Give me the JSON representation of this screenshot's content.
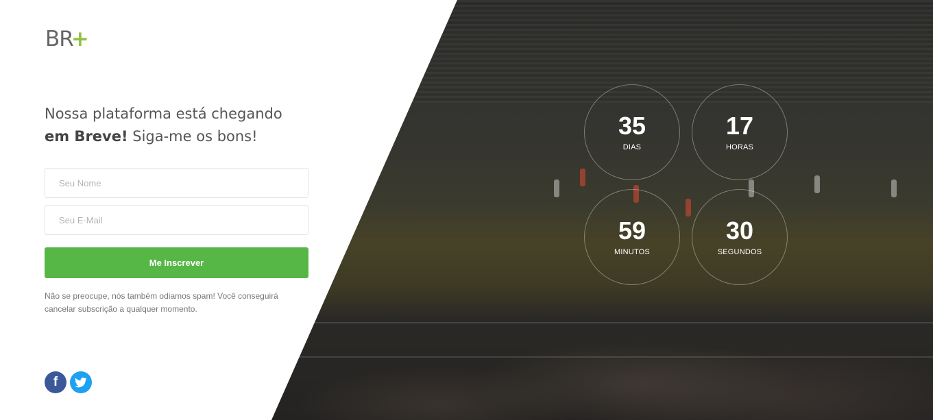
{
  "brand": {
    "logo_text": "BR",
    "logo_plus": "+"
  },
  "headline": {
    "line1": "Nossa plataforma está chegando",
    "bold": "em Breve!",
    "rest": " Siga-me os bons!"
  },
  "form": {
    "name_placeholder": "Seu Nome",
    "email_placeholder": "Seu E-Mail",
    "submit_label": "Me Inscrever"
  },
  "note": "Não se preocupe, nós também odiamos spam! Você conseguirá cancelar subscrição a qualquer momento.",
  "social": {
    "facebook_glyph": "f",
    "facebook": "facebook-icon",
    "twitter": "twitter-icon"
  },
  "countdown": {
    "days": {
      "value": "35",
      "label": "DIAS"
    },
    "hours": {
      "value": "17",
      "label": "HORAS"
    },
    "minutes": {
      "value": "59",
      "label": "MINUTOS"
    },
    "seconds": {
      "value": "30",
      "label": "SEGUNDOS"
    }
  },
  "colors": {
    "accent": "#56b746",
    "logo_plus": "#8fc23f",
    "facebook": "#3b5998",
    "twitter": "#1da1f2"
  }
}
